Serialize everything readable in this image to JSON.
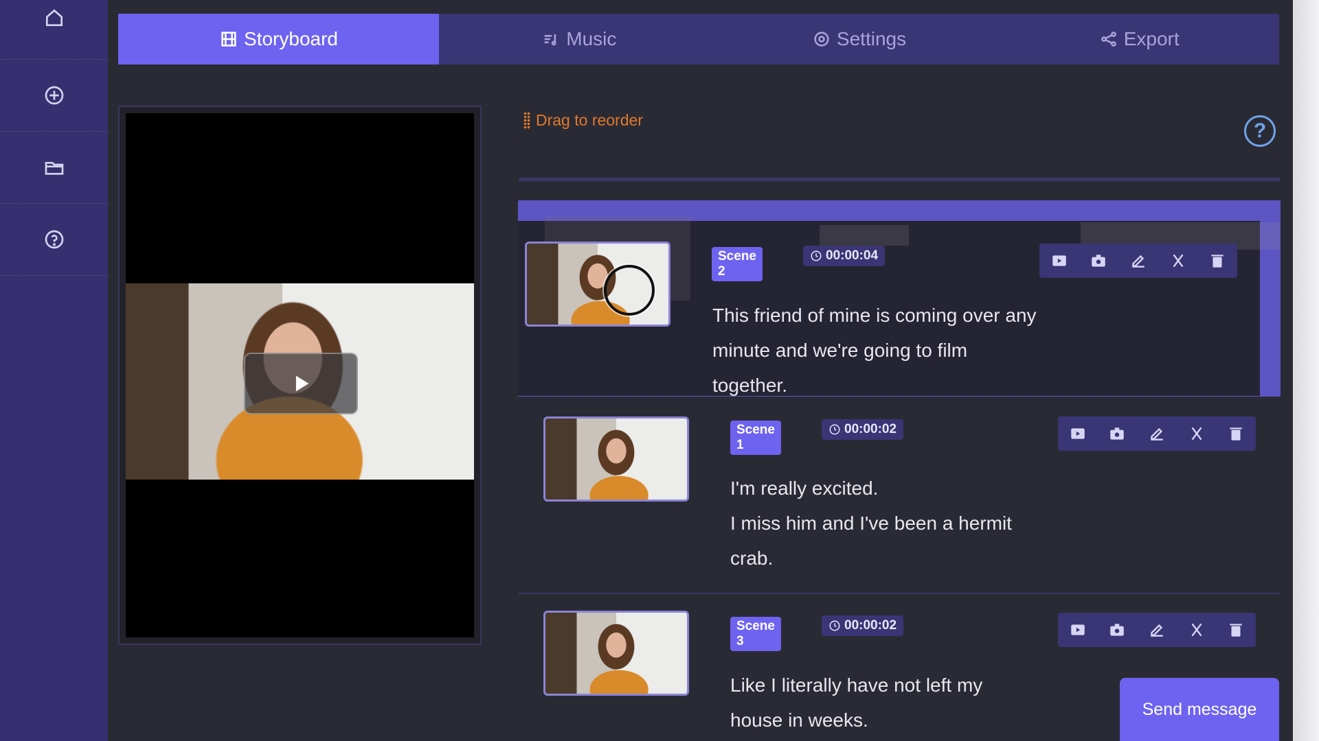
{
  "sidebar": {
    "items": [
      {
        "icon": "home-icon"
      },
      {
        "icon": "add-circle-icon"
      },
      {
        "icon": "folder-icon"
      },
      {
        "icon": "help-circle-icon"
      }
    ]
  },
  "tabs": [
    {
      "label": "Storyboard",
      "icon": "film-icon",
      "active": true
    },
    {
      "label": "Music",
      "icon": "music-icon",
      "active": false
    },
    {
      "label": "Settings",
      "icon": "gear-icon",
      "active": false
    },
    {
      "label": "Export",
      "icon": "share-icon",
      "active": false
    }
  ],
  "storyboard": {
    "drag_hint": "Drag to reorder",
    "help_label": "?",
    "scenes": [
      {
        "label": "Scene 2",
        "time": "00:00:04",
        "lines": [
          "This friend of mine is coming over any",
          "minute and we're going to film",
          "together."
        ],
        "dragging": true
      },
      {
        "label": "Scene 1",
        "time": "00:00:02",
        "lines": [
          "I'm really excited.",
          "I miss him and I've been a hermit",
          "crab."
        ]
      },
      {
        "label": "Scene 3",
        "time": "00:00:02",
        "lines": [
          "Like I literally have not left my",
          "house in weeks."
        ]
      }
    ],
    "scene_actions": [
      "preview-icon",
      "record-icon",
      "edit-icon",
      "cut-icon",
      "delete-icon"
    ]
  },
  "chat": {
    "send_label": "Send message"
  },
  "colors": {
    "accent": "#6e63f0",
    "sidebar": "#363070",
    "panel": "#2a2a35",
    "hint": "#e07a2c",
    "help": "#6fa3e8"
  }
}
